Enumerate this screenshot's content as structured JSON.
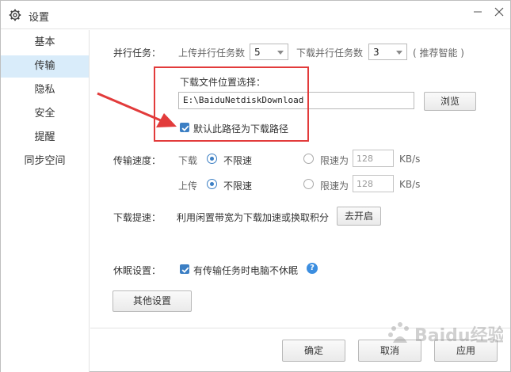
{
  "window": {
    "title": "设置"
  },
  "sidebar": {
    "items": [
      {
        "label": "基本",
        "active": false
      },
      {
        "label": "传输",
        "active": true
      },
      {
        "label": "隐私",
        "active": false
      },
      {
        "label": "安全",
        "active": false
      },
      {
        "label": "提醒",
        "active": false
      },
      {
        "label": "同步空间",
        "active": false
      }
    ]
  },
  "parallel": {
    "label": "并行任务：",
    "upload_label": "上传并行任务数",
    "upload_value": "5",
    "download_label": "下载并行任务数",
    "download_value": "3",
    "hint": "( 推荐智能 )"
  },
  "download_location": {
    "title": "下载文件位置选择：",
    "path": "E:\\BaiduNetdiskDownload",
    "browse_label": "浏览",
    "default_label": "默认此路径为下载路径",
    "default_checked": true
  },
  "speed": {
    "label": "传输速度：",
    "download_label": "下载",
    "upload_label": "上传",
    "unlimited_label": "不限速",
    "limit_label": "限速为",
    "download_limit_value": "128",
    "upload_limit_value": "128",
    "unit": "KB/s"
  },
  "boost": {
    "label": "下载提速：",
    "description": "利用闲置带宽为下载加速或换取积分",
    "button_label": "去开启"
  },
  "sleep": {
    "label": "休眠设置：",
    "option_label": "有传输任务时电脑不休眠",
    "checked": true
  },
  "other_settings_label": "其他设置",
  "footer": {
    "ok_label": "确定",
    "cancel_label": "取消",
    "apply_label": "应用"
  },
  "watermark_text": "Baidu经验",
  "colors": {
    "accent": "#3c7fc4",
    "sidebar_active_bg": "#d9ecfa",
    "annotation_red": "#e23b3b"
  }
}
